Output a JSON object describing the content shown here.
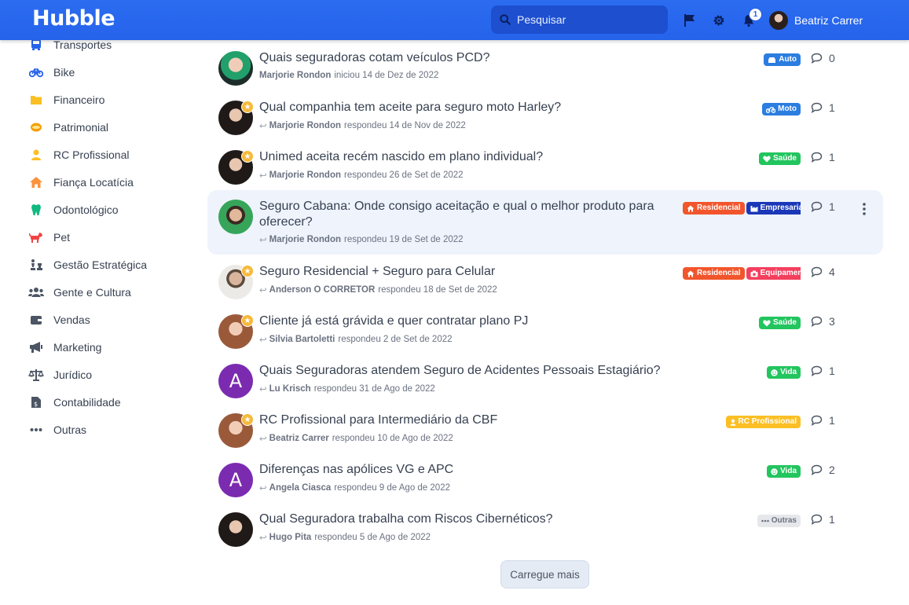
{
  "header": {
    "logo": "Hubble",
    "search_placeholder": "Pesquisar",
    "notifications_count": "1",
    "user_name": "Beatriz Carrer"
  },
  "sidebar": {
    "items": [
      {
        "label": "Transportes",
        "icon": "bus-icon",
        "color": "#2563eb"
      },
      {
        "label": "Bike",
        "icon": "bike-icon",
        "color": "#2563eb"
      },
      {
        "label": "Financeiro",
        "icon": "folder-icon",
        "color": "#fbbf24"
      },
      {
        "label": "Patrimonial",
        "icon": "ring-icon",
        "color": "#f59e0b"
      },
      {
        "label": "RC Profissional",
        "icon": "worker-icon",
        "color": "#fbbf24"
      },
      {
        "label": "Fiança Locatícia",
        "icon": "house-icon",
        "color": "#fb923c"
      },
      {
        "label": "Odontológico",
        "icon": "tooth-icon",
        "color": "#10b981"
      },
      {
        "label": "Pet",
        "icon": "dog-icon",
        "color": "#ef4444"
      },
      {
        "label": "Gestão Estratégica",
        "icon": "chess-icon",
        "color": "#4b5563"
      },
      {
        "label": "Gente e Cultura",
        "icon": "users-icon",
        "color": "#4b5563"
      },
      {
        "label": "Vendas",
        "icon": "wallet-icon",
        "color": "#4b5563"
      },
      {
        "label": "Marketing",
        "icon": "megaphone-icon",
        "color": "#4b5563"
      },
      {
        "label": "Jurídico",
        "icon": "scale-icon",
        "color": "#4b5563"
      },
      {
        "label": "Contabilidade",
        "icon": "invoice-icon",
        "color": "#4b5563"
      },
      {
        "label": "Outras",
        "icon": "ellipsis-icon",
        "color": "#4b5563"
      }
    ]
  },
  "topics": [
    {
      "title": "Quais seguradoras cotam veículos PCD?",
      "author": "Marjorie Rondon",
      "action": "iniciou 14 de Dez de 2022",
      "reply": false,
      "comments": "0",
      "tags": [
        {
          "label": "Auto",
          "icon": "car-icon",
          "color": "#2b7de0"
        }
      ]
    },
    {
      "title": "Qual companhia tem aceite para seguro moto Harley?",
      "author": "Marjorie Rondon",
      "action": "respondeu 14 de Nov de 2022",
      "reply": true,
      "comments": "1",
      "tags": [
        {
          "label": "Moto",
          "icon": "motorcycle-icon",
          "color": "#2b7de0"
        }
      ]
    },
    {
      "title": "Unimed aceita recém nascido em plano individual?",
      "author": "Marjorie Rondon",
      "action": "respondeu 26 de Set de 2022",
      "reply": true,
      "comments": "1",
      "tags": [
        {
          "label": "Saúde",
          "icon": "heart-icon",
          "color": "#22c55e"
        }
      ]
    },
    {
      "title": "Seguro Cabana: Onde consigo aceitação e qual o melhor produto para oferecer?",
      "author": "Marjorie Rondon",
      "action": "respondeu 19 de Set de 2022",
      "reply": true,
      "comments": "1",
      "tags": [
        {
          "label": "Residencial",
          "icon": "house-icon",
          "color": "#f2552c"
        },
        {
          "label": "Empresarial",
          "icon": "factory-icon",
          "color": "#1a37b8"
        }
      ]
    },
    {
      "title": "Seguro Residencial + Seguro para Celular",
      "author": "Anderson O CORRETOR",
      "action": "respondeu 18 de Set de 2022",
      "reply": true,
      "comments": "4",
      "tags": [
        {
          "label": "Residencial",
          "icon": "house-icon",
          "color": "#f2552c"
        },
        {
          "label": "Equipamentos",
          "icon": "camera-icon",
          "color": "#f43f5e"
        }
      ]
    },
    {
      "title": "Cliente já está grávida e quer contratar plano PJ",
      "author": "Silvia Bartoletti",
      "action": "respondeu 2 de Set de 2022",
      "reply": true,
      "comments": "3",
      "tags": [
        {
          "label": "Saúde",
          "icon": "heart-icon",
          "color": "#22c55e"
        }
      ]
    },
    {
      "title": "Quais Seguradoras atendem Seguro de Acidentes Pessoais Estagiário?",
      "author": "Lu Krisch",
      "action": "respondeu 31 de Ago de 2022",
      "reply": true,
      "comments": "1",
      "tags": [
        {
          "label": "Vida",
          "icon": "smile-icon",
          "color": "#22c55e"
        }
      ]
    },
    {
      "title": "RC Profissional para Intermediário da CBF",
      "author": "Beatriz Carrer",
      "action": "respondeu 10 de Ago de 2022",
      "reply": true,
      "comments": "1",
      "tags": [
        {
          "label": "RC Profissional",
          "icon": "worker-icon",
          "color": "#fbbf24"
        }
      ]
    },
    {
      "title": "Diferenças nas apólices VG e APC",
      "author": "Angela Ciasca",
      "action": "respondeu 9 de Ago de 2022",
      "reply": true,
      "comments": "2",
      "tags": [
        {
          "label": "Vida",
          "icon": "smile-icon",
          "color": "#22c55e"
        }
      ]
    },
    {
      "title": "Qual Seguradora trabalha com Riscos Cibernéticos?",
      "author": "Hugo Pita",
      "action": "respondeu 5 de Ago de 2022",
      "reply": true,
      "comments": "1",
      "tags": [
        {
          "label": "Outras",
          "icon": "ellipsis-icon",
          "color": "#e5e7eb"
        }
      ]
    }
  ],
  "avatars": [
    "A",
    "A"
  ],
  "load_more_label": "Carregue mais"
}
